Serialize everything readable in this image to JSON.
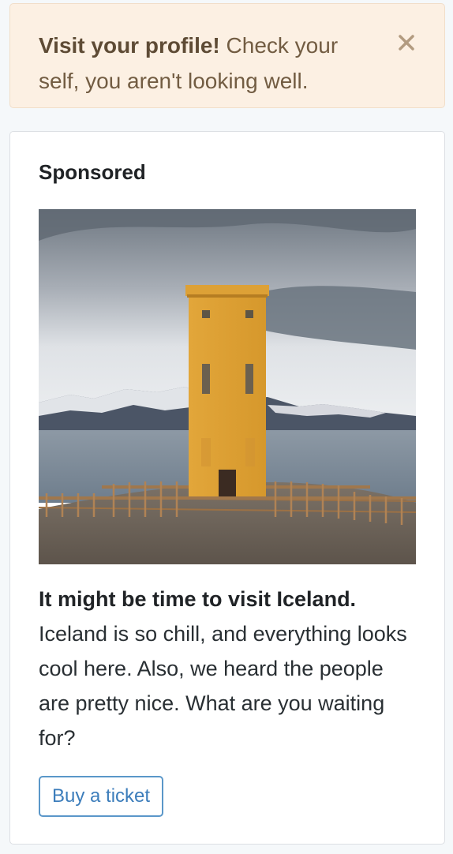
{
  "alert": {
    "title": "Visit your profile!",
    "message": "Check your self, you aren't looking well.",
    "close_icon": "close-icon"
  },
  "ad_card": {
    "heading": "Sponsored",
    "image_icon": "iceland-tower-photo",
    "headline": "It might be time to visit Iceland.",
    "body": "Iceland is so chill, and everything looks cool here. Also, we heard the people are pretty nice. What are you waiting for?",
    "button_label": "Buy a ticket"
  },
  "colors": {
    "alert_bg": "#fcf0e3",
    "alert_text": "#725c42",
    "button_accent": "#5a97c9"
  }
}
